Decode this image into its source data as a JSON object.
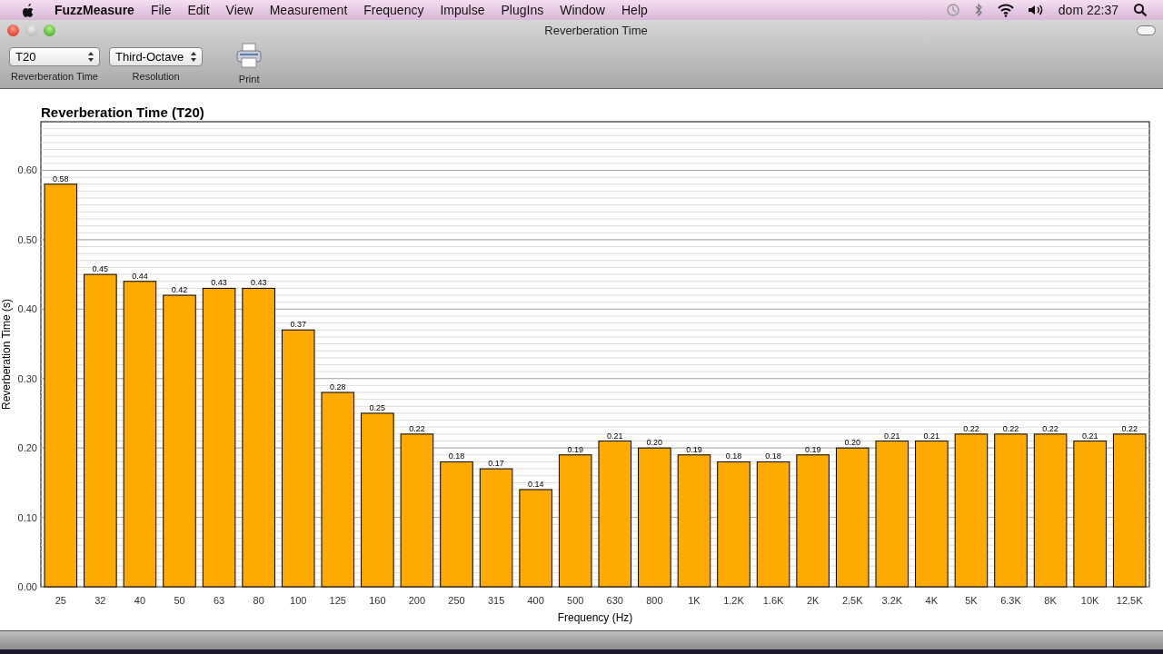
{
  "menu_bar": {
    "app": "FuzzMeasure",
    "items": [
      "File",
      "Edit",
      "View",
      "Measurement",
      "Frequency",
      "Impulse",
      "PlugIns",
      "Window",
      "Help"
    ],
    "clock": "dom 22:37"
  },
  "window": {
    "title": "Reverberation Time"
  },
  "toolbar": [
    {
      "kind": "popup",
      "value": "T20",
      "label": "Reverberation Time"
    },
    {
      "kind": "popup",
      "value": "Third-Octave",
      "label": "Resolution"
    },
    {
      "kind": "print",
      "label": "Print"
    }
  ],
  "chart_data": {
    "type": "bar",
    "title": "Reverberation Time (T20)",
    "xlabel": "Frequency (Hz)",
    "ylabel": "Reverberation Time (s)",
    "categories": [
      "25",
      "32",
      "40",
      "50",
      "63",
      "80",
      "100",
      "125",
      "160",
      "200",
      "250",
      "315",
      "400",
      "500",
      "630",
      "800",
      "1K",
      "1.2K",
      "1.6K",
      "2K",
      "2.5K",
      "3.2K",
      "4K",
      "5K",
      "6.3K",
      "8K",
      "10K",
      "12.5K"
    ],
    "series": [
      {
        "color": "#ffaa00",
        "values": [
          0.58,
          0.45,
          0.44,
          0.42,
          0.43,
          0.43,
          0.37,
          0.28,
          0.25,
          0.22,
          0.18,
          0.17,
          0.14,
          0.19,
          0.21,
          0.2,
          0.19,
          0.18,
          0.18,
          0.19,
          0.2,
          0.21,
          0.21,
          0.22,
          0.22,
          0.22,
          0.21,
          0.22
        ]
      }
    ],
    "ylim": [
      0,
      0.67
    ],
    "yticks": [
      {
        "value": 0,
        "label": "0.00"
      },
      {
        "value": 0.1,
        "label": "0.10"
      },
      {
        "value": 0.2,
        "label": "0.20"
      },
      {
        "value": 0.3,
        "label": "0.30"
      },
      {
        "value": 0.4,
        "label": "0.40"
      },
      {
        "value": 0.5,
        "label": "0.50"
      },
      {
        "value": 0.6,
        "label": "0.60"
      }
    ],
    "grid": true,
    "value_labels": [
      "0.58",
      "0.45",
      "0.44",
      "0.42",
      "0.43",
      "0.43",
      "0.37",
      "0.28",
      "0.25",
      "0.22",
      "0.18",
      "0.17",
      "0.14",
      "0.19",
      "0.21",
      "0.20",
      "0.19",
      "0.18",
      "0.18",
      "0.19",
      "0.20",
      "0.21",
      "0.21",
      "0.22",
      "0.22",
      "0.22",
      "0.21",
      "0.22"
    ]
  }
}
